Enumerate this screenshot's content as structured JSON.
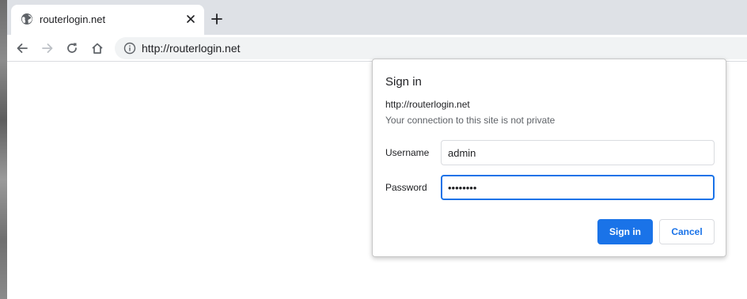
{
  "tab": {
    "title": "routerlogin.net",
    "favicon": "globe-icon",
    "close_icon": "close-icon"
  },
  "toolbar": {
    "back_icon": "arrow-left-icon",
    "forward_icon": "arrow-right-icon",
    "reload_icon": "reload-icon",
    "home_icon": "home-icon",
    "info_icon": "info-icon",
    "url": "http://routerlogin.net"
  },
  "dialog": {
    "title": "Sign in",
    "origin": "http://routerlogin.net",
    "warning": "Your connection to this site is not private",
    "username_label": "Username",
    "username_value": "admin",
    "password_label": "Password",
    "password_value": "••••••••",
    "sign_in_label": "Sign in",
    "cancel_label": "Cancel"
  },
  "colors": {
    "accent": "#1a73e8",
    "tabstrip": "#dee1e6",
    "omnibox": "#f1f3f4"
  }
}
